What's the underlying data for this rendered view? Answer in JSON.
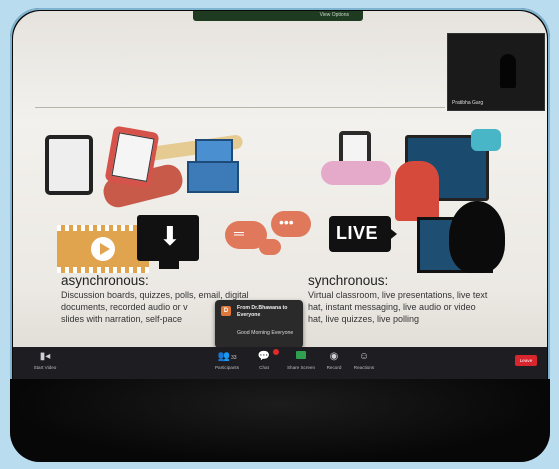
{
  "meeting": {
    "view_options_label": "View Options",
    "participant_name": "Pratibha Garg",
    "colors": {
      "toolbar_bg": "#1d1d22",
      "leave_red": "#d8262f",
      "share_green": "#2ea04f",
      "slide_bg": "#f0eee9"
    }
  },
  "slide": {
    "async_heading": "asynchronous:",
    "async_lines": [
      "Discussion boards, quizzes, polls, email, digital",
      "documents, recorded audio or v",
      "slides with narration, self-pace"
    ],
    "sync_heading": "synchronous:",
    "sync_lines": [
      "Virtual classroom, live presentations, live text",
      "hat, instant messaging, live audio or video",
      "hat, live quizzes, live polling"
    ],
    "live_badge": "LIVE"
  },
  "chat_popup": {
    "avatar_letter": "D",
    "from": "From Dr.Bhawana to Everyone",
    "message": "Good Morning Everyone"
  },
  "toolbar": {
    "start_video": "Start Video",
    "participants": "Participants",
    "participants_count": "33",
    "chat": "Chat",
    "share_screen": "Share Screen",
    "record": "Record",
    "reactions": "Reactions",
    "leave": "Leave"
  }
}
